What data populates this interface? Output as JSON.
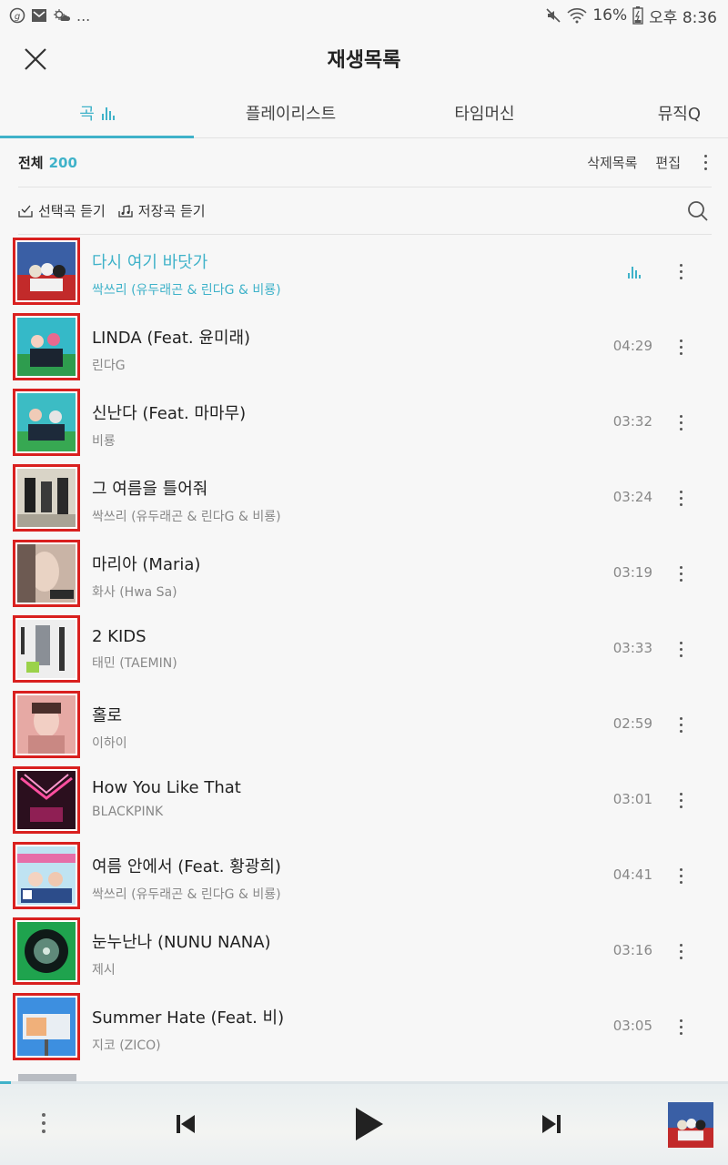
{
  "status_bar": {
    "left_icons": [
      "g-icon",
      "mail-icon",
      "weather-icon"
    ],
    "left_more": "...",
    "battery": "16%",
    "time": "오후 8:36"
  },
  "header": {
    "title": "재생목록"
  },
  "tabs": [
    {
      "label": "곡",
      "active": true
    },
    {
      "label": "플레이리스트",
      "active": false
    },
    {
      "label": "타임머신",
      "active": false
    },
    {
      "label": "뮤직Q",
      "active": false
    }
  ],
  "summary": {
    "total_label": "전체",
    "total_count": "200",
    "deleted_label": "삭제목록",
    "edit_label": "편집"
  },
  "actions": {
    "selected_play": "선택곡 듣기",
    "saved_play": "저장곡 듣기"
  },
  "songs": [
    {
      "title": "다시 여기 바닷가",
      "artist": "싹쓰리 (유두래곤 & 린다G & 비룡)",
      "duration": "",
      "playing": true
    },
    {
      "title": "LINDA (Feat. 윤미래)",
      "artist": "린다G",
      "duration": "04:29",
      "playing": false
    },
    {
      "title": "신난다 (Feat. 마마무)",
      "artist": "비룡",
      "duration": "03:32",
      "playing": false
    },
    {
      "title": "그 여름을 틀어줘",
      "artist": "싹쓰리 (유두래곤 & 린다G & 비룡)",
      "duration": "03:24",
      "playing": false
    },
    {
      "title": "마리아 (Maria)",
      "artist": "화사 (Hwa Sa)",
      "duration": "03:19",
      "playing": false
    },
    {
      "title": "2 KIDS",
      "artist": "태민 (TAEMIN)",
      "duration": "03:33",
      "playing": false
    },
    {
      "title": "홀로",
      "artist": "이하이",
      "duration": "02:59",
      "playing": false
    },
    {
      "title": "How You Like That",
      "artist": "BLACKPINK",
      "duration": "03:01",
      "playing": false
    },
    {
      "title": "여름 안에서 (Feat. 황광희)",
      "artist": "싹쓰리 (유두래곤 & 린다G & 비룡)",
      "duration": "04:41",
      "playing": false
    },
    {
      "title": "눈누난나 (NUNU NANA)",
      "artist": "제시",
      "duration": "03:16",
      "playing": false
    },
    {
      "title": "Summer Hate (Feat. 비)",
      "artist": "지코 (ZICO)",
      "duration": "03:05",
      "playing": false
    }
  ],
  "player": {
    "progress": 0.015
  },
  "colors": {
    "accent": "#3fb2c9",
    "cover_border": "#d9201f"
  }
}
